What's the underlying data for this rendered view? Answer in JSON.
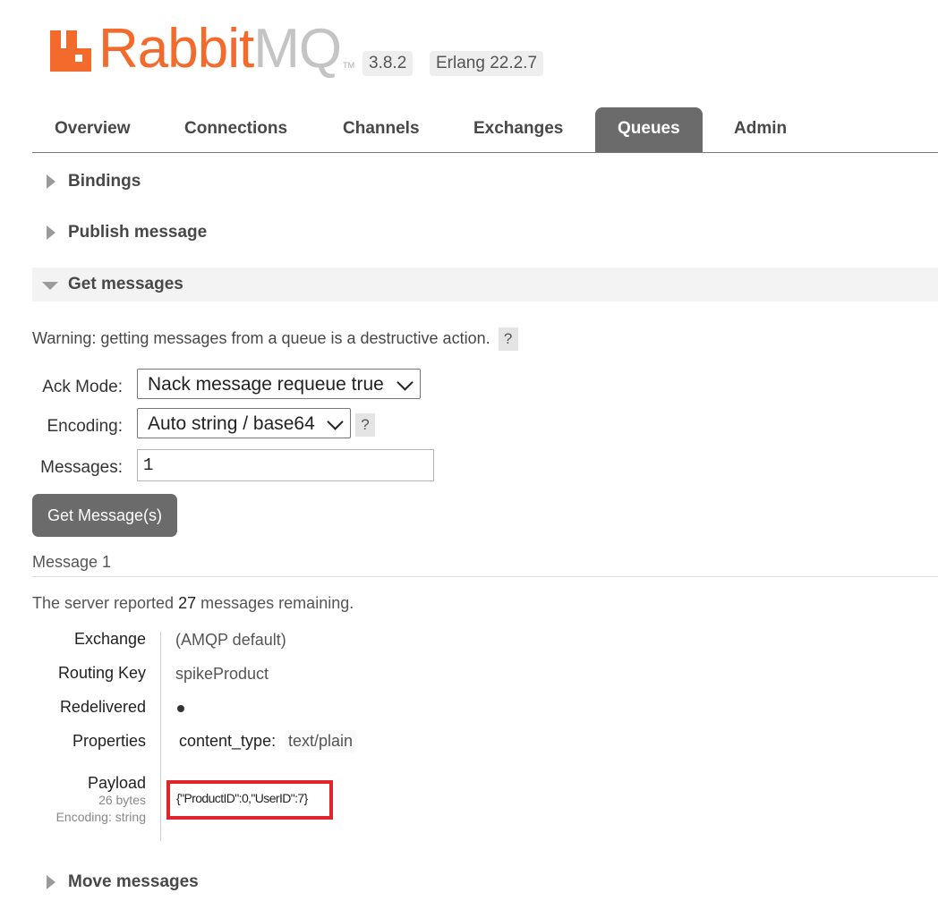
{
  "header": {
    "brand_part1": "Rabbit",
    "brand_part2": "MQ",
    "brand_tm": "TM",
    "version": "3.8.2",
    "erlang": "Erlang 22.2.7",
    "brand_color": "#f26b2c"
  },
  "nav": {
    "tabs": [
      "Overview",
      "Connections",
      "Channels",
      "Exchanges",
      "Queues",
      "Admin"
    ],
    "active": "Queues"
  },
  "sections": {
    "bindings": "Bindings",
    "publish": "Publish message",
    "get": "Get messages",
    "move": "Move messages"
  },
  "get_messages": {
    "warning": "Warning: getting messages from a queue is a destructive action.",
    "help_glyph": "?",
    "ack_mode_label": "Ack Mode:",
    "ack_mode_value": "Nack message requeue true",
    "encoding_label": "Encoding:",
    "encoding_value": "Auto string / base64",
    "messages_label": "Messages:",
    "messages_value": "1",
    "button": "Get Message(s)"
  },
  "result": {
    "title": "Message 1",
    "remaining_prefix": "The server reported",
    "remaining_count": "27",
    "remaining_suffix": "messages remaining.",
    "exchange_label": "Exchange",
    "exchange_value": "(AMQP default)",
    "routing_key_label": "Routing Key",
    "routing_key_value": "spikeProduct",
    "redelivered_label": "Redelivered",
    "redelivered_value": "●",
    "properties_label": "Properties",
    "property_key": "content_type:",
    "property_value": "text/plain",
    "payload_label": "Payload",
    "payload_size": "26 bytes",
    "payload_encoding": "Encoding: string",
    "payload_value": "{\"ProductID\":0,\"UserID\":7}",
    "highlight_color": "#e1252f"
  }
}
